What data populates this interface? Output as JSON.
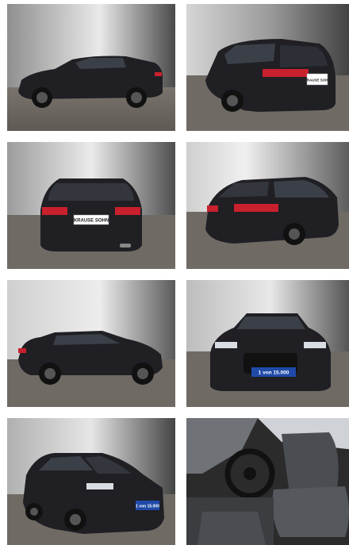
{
  "gallery": {
    "photos": [
      {
        "view": "side-left"
      },
      {
        "view": "rear-three-quarter-left",
        "plate": "KRAUSE SOHN"
      },
      {
        "view": "rear",
        "plate": "KRAUSE SOHN"
      },
      {
        "view": "rear-three-quarter-right",
        "plate": ""
      },
      {
        "view": "side-right"
      },
      {
        "view": "front",
        "plate": "1 von 15.000"
      },
      {
        "view": "front-three-quarter-left",
        "plate": "1 von 15.000"
      },
      {
        "view": "interior-driver-seat"
      }
    ]
  },
  "colors": {
    "car_body": "#1f1f24",
    "backdrop_light": "#e6e6e6",
    "backdrop_dark": "#3a3a3a",
    "floor": "#6f6a64",
    "taillight": "#c8202c",
    "plate_badge": "#1f4aa8"
  }
}
